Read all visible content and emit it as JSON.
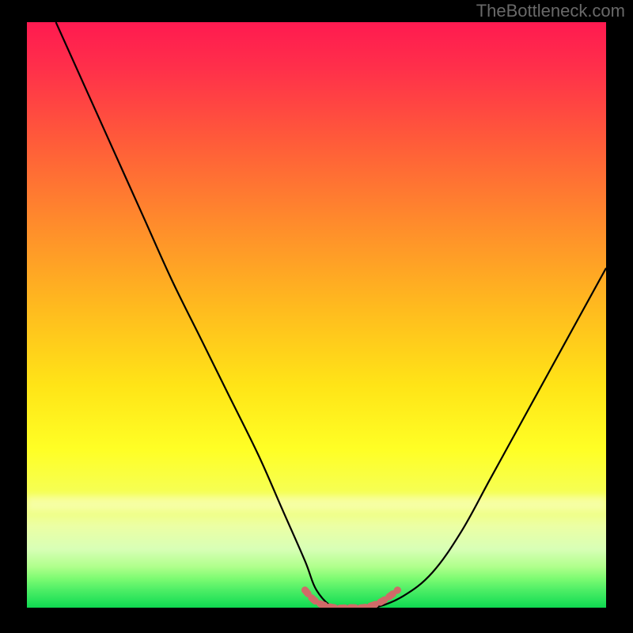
{
  "attribution": "TheBottleneck.com",
  "colors": {
    "page_bg": "#000000",
    "grad_top": "#ff1a50",
    "grad_mid": "#ffe417",
    "grad_bottom": "#0fd750",
    "curve": "#000000",
    "valley": "#d06a68"
  },
  "chart_data": {
    "type": "line",
    "title": "",
    "xlabel": "",
    "ylabel": "",
    "xlim": [
      0,
      100
    ],
    "ylim": [
      0,
      100
    ],
    "series": [
      {
        "name": "bottleneck-curve",
        "x": [
          5,
          10,
          15,
          20,
          25,
          30,
          35,
          40,
          44,
          48,
          50,
          53,
          56,
          60,
          65,
          70,
          75,
          80,
          85,
          90,
          95,
          100
        ],
        "y": [
          100,
          89,
          78,
          67,
          56,
          46,
          36,
          26,
          17,
          8,
          3,
          0,
          0,
          0,
          2,
          6,
          13,
          22,
          31,
          40,
          49,
          58
        ]
      },
      {
        "name": "valley-highlight",
        "x": [
          48,
          50,
          53,
          56,
          58,
          60,
          62,
          64
        ],
        "y": [
          3,
          1,
          0,
          0,
          0,
          0.5,
          1.5,
          3
        ]
      }
    ],
    "annotations": []
  }
}
